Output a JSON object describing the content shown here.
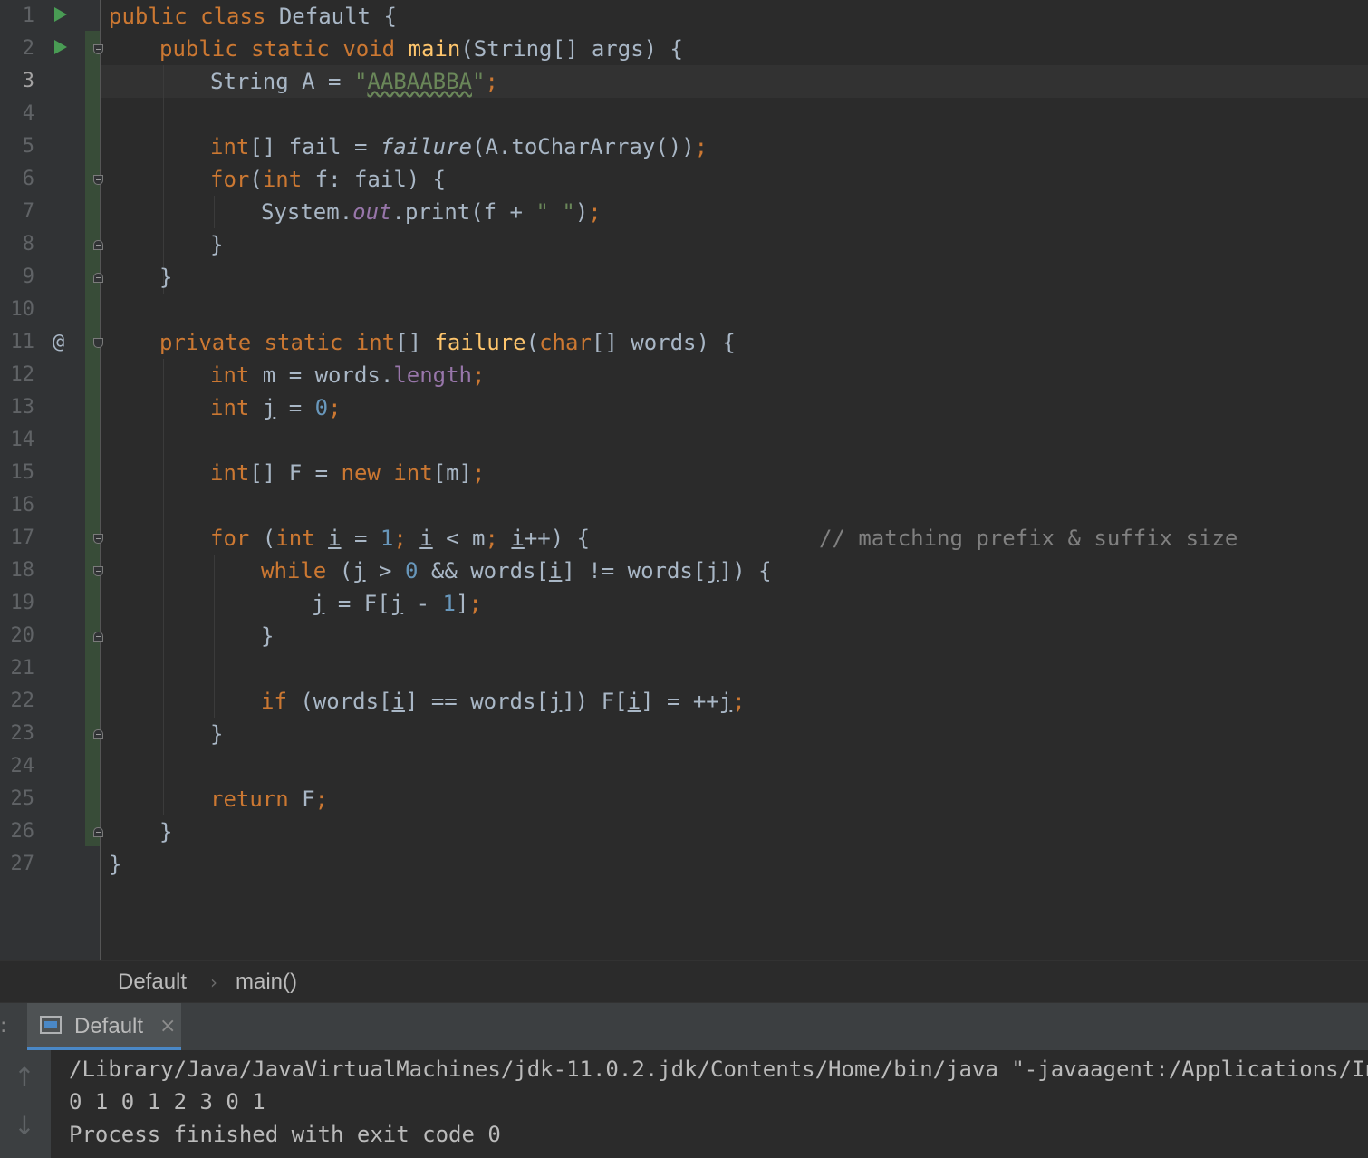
{
  "editor": {
    "line_numbers": [
      "1",
      "2",
      "3",
      "4",
      "5",
      "6",
      "7",
      "8",
      "9",
      "10",
      "11",
      "12",
      "13",
      "14",
      "15",
      "16",
      "17",
      "18",
      "19",
      "20",
      "21",
      "22",
      "23",
      "24",
      "25",
      "26",
      "27"
    ],
    "current_line": "3",
    "code": {
      "l1": {
        "kw1": "public",
        "kw2": "class",
        "name": "Default",
        "brace": "{"
      },
      "l2": {
        "kw1": "public",
        "kw2": "static",
        "kw3": "void",
        "fn": "main",
        "params": "(String[] args) {"
      },
      "l3": {
        "decl": "String A = ",
        "q1": "\"",
        "str": "AABAABBA",
        "q2": "\"",
        "semi": ";"
      },
      "l5": {
        "type": "int",
        "decl": "[] fail = ",
        "call": "failure",
        "args": "(A.toCharArray())",
        "semi": ";"
      },
      "l6": {
        "kw": "for",
        "p1": "(",
        "type": "int",
        "rest": " f: fail) {"
      },
      "l7": {
        "cls": "System.",
        "fld": "out",
        "call": ".print(f + ",
        "str": "\" \"",
        "end": ")",
        "semi": ";"
      },
      "l8": {
        "brace": "}"
      },
      "l9": {
        "brace": "}"
      },
      "l11": {
        "kw1": "private",
        "kw2": "static",
        "type": "int",
        "arr": "[] ",
        "fn": "failure",
        "p1": "(",
        "ctype": "char",
        "rest": "[] words) {"
      },
      "l12": {
        "type": "int",
        "decl": " m = words.",
        "fld": "length",
        "semi": ";"
      },
      "l13": {
        "type": "int",
        "sp": " ",
        "var": "j",
        "eq": " = ",
        "num": "0",
        "semi": ";"
      },
      "l15": {
        "type": "int",
        "decl": "[] F = ",
        "kw": "new",
        "sp": " ",
        "type2": "int",
        "rest": "[m]",
        "semi": ";"
      },
      "l17": {
        "kw": "for",
        "p1": " (",
        "type": "int",
        "sp": " ",
        "i1": "i",
        "eq": " = ",
        "num": "1",
        "s1": ";",
        "sp2": " ",
        "i2": "i",
        "lt": " < m",
        "s2": ";",
        "sp3": " ",
        "i3": "i",
        "inc": "++) {",
        "comment": "// matching prefix & suffix size"
      },
      "l18": {
        "kw": "while",
        "p1": " (",
        "j1": "j",
        "gt": " > ",
        "num": "0",
        "mid": " && words[",
        "i1": "i",
        "mid2": "] != words[",
        "j2": "j",
        "end": "]) {"
      },
      "l19": {
        "j1": "j",
        "mid": " = F[",
        "j2": "j",
        "minus": " - ",
        "num": "1",
        "end": "]",
        "semi": ";"
      },
      "l20": {
        "brace": "}"
      },
      "l22": {
        "kw": "if",
        "p1": " (words[",
        "i1": "i",
        "mid": "] == words[",
        "j1": "j",
        "mid2": "]) F[",
        "i2": "i",
        "mid3": "] = ++",
        "j2": "j",
        "semi": ";"
      },
      "l23": {
        "brace": "}"
      },
      "l25": {
        "kw": "return",
        "rest": " F",
        "semi": ";"
      },
      "l26": {
        "brace": "}"
      },
      "l27": {
        "brace": "}"
      }
    },
    "gutter_marker_at": "@"
  },
  "breadcrumb": {
    "class": "Default",
    "separator": "›",
    "method": "main()"
  },
  "run_panel": {
    "tab_label": "Default",
    "tab_close": "×",
    "handle": ":",
    "arrow_up": "↑",
    "arrow_down": "↓",
    "console_lines": [
      "/Library/Java/JavaVirtualMachines/jdk-11.0.2.jdk/Contents/Home/bin/java \"-javaagent:/Applications/Intel",
      "0 1 0 1 2 3 0 1",
      "Process finished with exit code 0"
    ]
  },
  "colors": {
    "background": "#2b2b2b",
    "keyword": "#cc7832",
    "method": "#ffc66d",
    "string": "#6a8759",
    "number": "#6897bb",
    "field": "#9876aa",
    "comment": "#808080",
    "run_icon": "#499c54"
  }
}
